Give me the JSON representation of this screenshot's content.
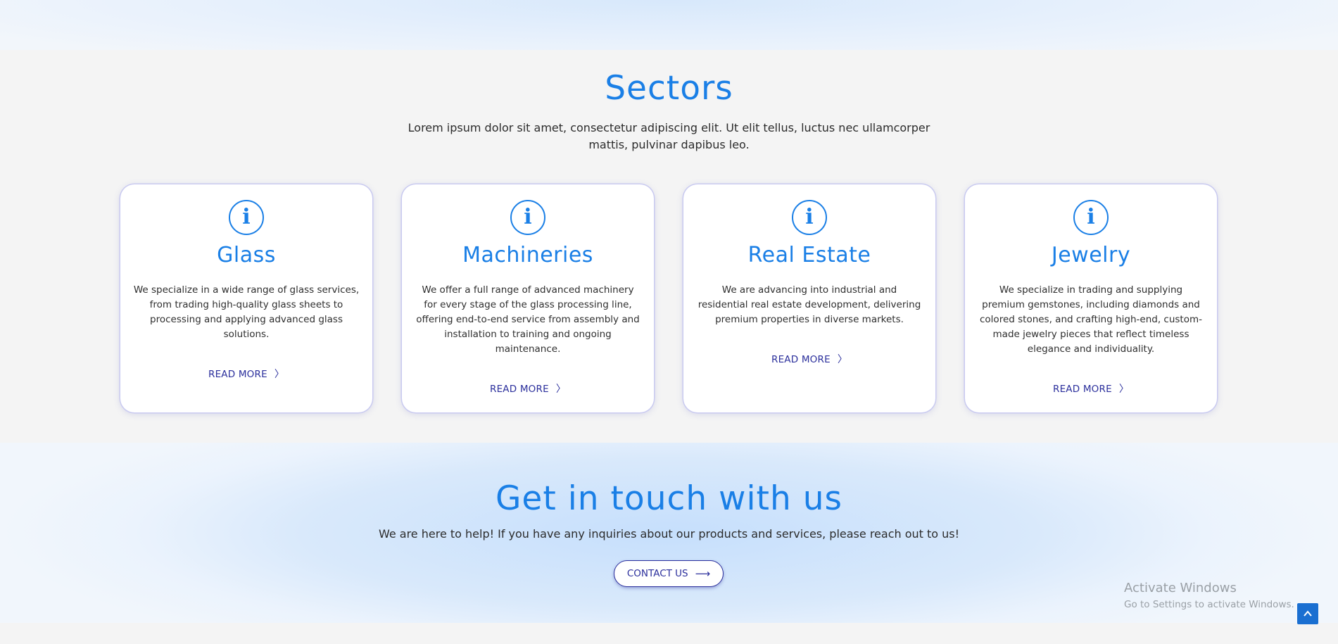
{
  "sectors": {
    "title": "Sectors",
    "description": "Lorem ipsum dolor sit amet, consectetur adipiscing elit. Ut elit tellus, luctus nec ullamcorper mattis, pulvinar dapibus leo.",
    "cards": [
      {
        "title": "Glass",
        "description": "We specialize in a wide range of glass services, from trading high-quality glass sheets to processing and applying advanced glass solutions.",
        "link_label": "READ MORE",
        "icon": "info-icon"
      },
      {
        "title": "Machineries",
        "description": "We offer a full range of advanced machinery for every stage of the glass processing line, offering end-to-end service from assembly and installation to training and ongoing maintenance.",
        "link_label": "READ MORE",
        "icon": "info-icon"
      },
      {
        "title": "Real Estate",
        "description": "We are advancing into industrial and residential real estate development, delivering premium properties in diverse markets.",
        "link_label": "READ MORE",
        "icon": "info-icon"
      },
      {
        "title": "Jewelry",
        "description": "We specialize in trading and supplying premium gemstones, including diamonds and colored stones, and crafting high-end, custom-made jewelry pieces that reflect timeless elegance and individuality.",
        "link_label": "READ MORE",
        "icon": "info-icon"
      }
    ]
  },
  "contact": {
    "title": "Get in touch with us",
    "description": "We are here to help! If you have any inquiries about our products and services, please reach out to us!",
    "button_label": "CONTACT US"
  },
  "watermark": {
    "title": "Activate Windows",
    "subtitle": "Go to Settings to activate Windows."
  },
  "colors": {
    "accent_blue": "#1a7fe6",
    "link_navy": "#2b2f9c",
    "background": "#f4f4f4",
    "scroll_button": "#1a6fd1"
  }
}
